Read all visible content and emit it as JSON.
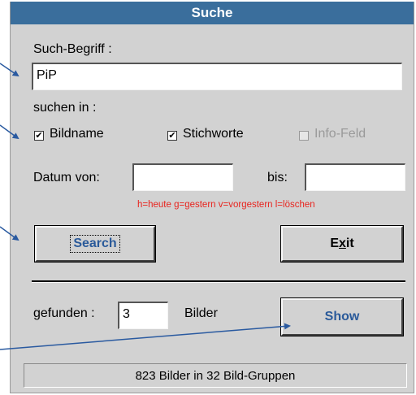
{
  "window": {
    "title": "Suche"
  },
  "search": {
    "label": "Such-Begriff :",
    "value": "PiP"
  },
  "scope": {
    "label": "suchen in :",
    "options": [
      {
        "label": "Bildname",
        "checked": true,
        "enabled": true
      },
      {
        "label": "Stichworte",
        "checked": true,
        "enabled": true
      },
      {
        "label": "Info-Feld",
        "checked": false,
        "enabled": false
      }
    ]
  },
  "date": {
    "from_label": "Datum von:",
    "from_value": "",
    "to_label": "bis:",
    "to_value": "",
    "hint": "h=heute  g=gestern  v=vorgestern  l=löschen"
  },
  "buttons": {
    "search": "Search",
    "exit_prefix": "E",
    "exit_accel": "x",
    "exit_suffix": "it",
    "show": "Show"
  },
  "results": {
    "found_label": "gefunden :",
    "found_value": "3",
    "found_unit": "Bilder"
  },
  "status": {
    "text": "823 Bilder in 32 Bild-Gruppen"
  },
  "colors": {
    "title_bg": "#3a6e9c",
    "hint": "#e8241e",
    "arrow": "#2a5aa0",
    "button_blue_text": "#2a5a9a"
  }
}
